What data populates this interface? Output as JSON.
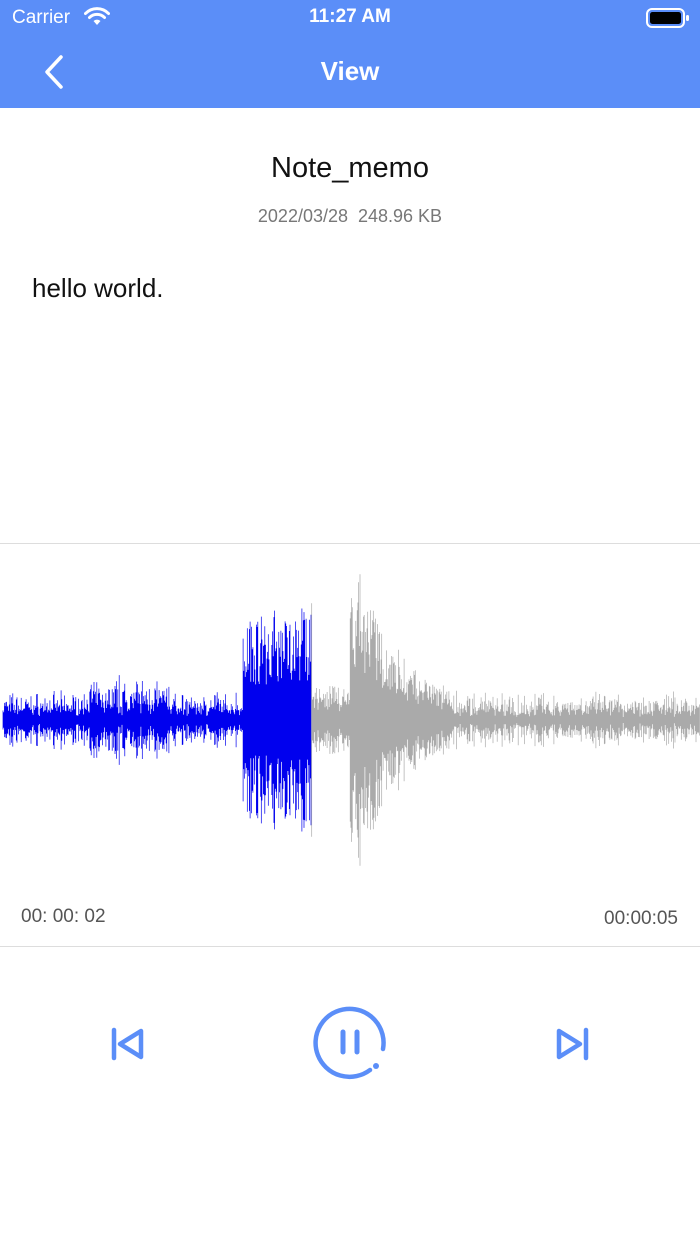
{
  "status_bar": {
    "carrier": "Carrier",
    "time": "11:27 AM"
  },
  "nav": {
    "title": "View"
  },
  "note": {
    "title": "Note_memo",
    "date": "2022/03/28",
    "size": "248.96 KB",
    "body": "hello world."
  },
  "player": {
    "current_time": "00: 00: 02",
    "total_time": "00:00:05",
    "progress": 0.445,
    "played_color": "#0000ee",
    "unplayed_color": "#aaaaaa",
    "accent_color": "#5b8ef8",
    "controls": {
      "previous_icon": "skip-previous-icon",
      "play_pause_icon": "pause-icon",
      "next_icon": "skip-next-icon"
    }
  }
}
